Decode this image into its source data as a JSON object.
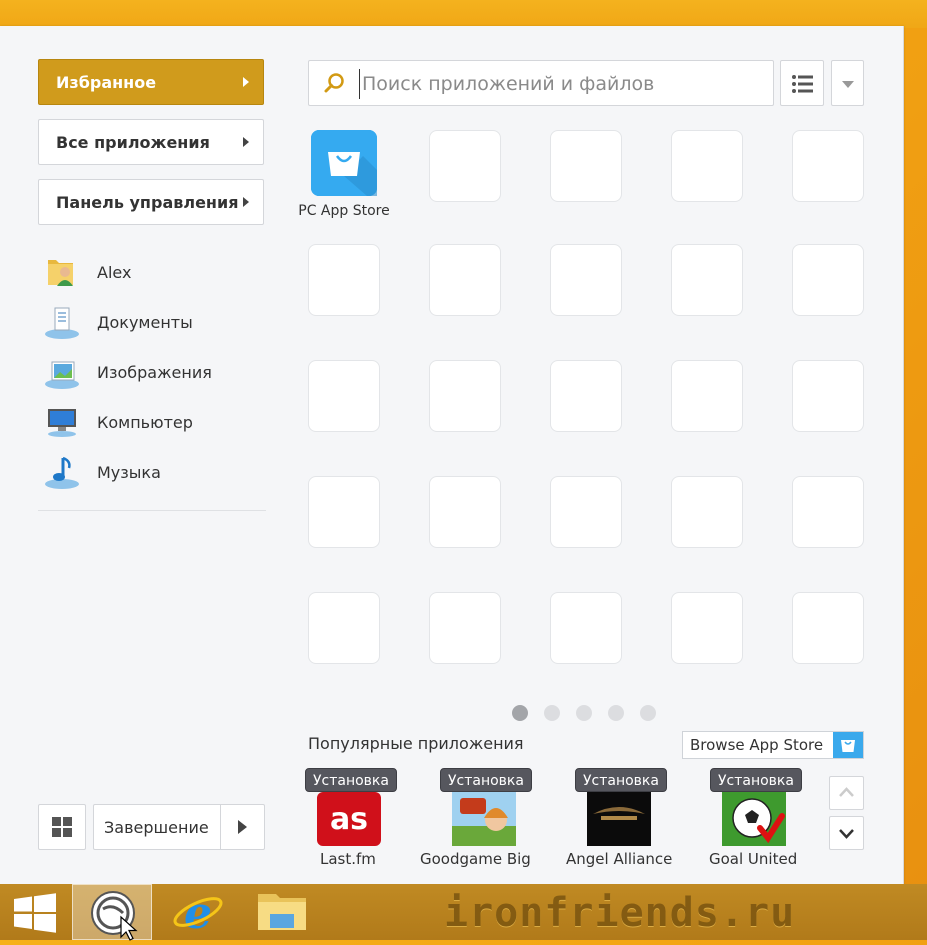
{
  "nav": {
    "favorites": "Избранное",
    "all_apps": "Все приложения",
    "control_panel": "Панель управления"
  },
  "places": [
    {
      "label": "Alex",
      "icon": "user-folder-icon"
    },
    {
      "label": "Документы",
      "icon": "documents-icon"
    },
    {
      "label": "Изображения",
      "icon": "pictures-icon"
    },
    {
      "label": "Компьютер",
      "icon": "computer-icon"
    },
    {
      "label": "Музыка",
      "icon": "music-icon"
    }
  ],
  "search": {
    "placeholder": "Поиск приложений и файлов"
  },
  "apps": [
    {
      "label": "PC App Store",
      "icon": "shopping-bag-icon"
    }
  ],
  "pagination": {
    "pages": 5,
    "current": 1
  },
  "popular": {
    "title": "Популярные приложения",
    "browse_label": "Browse App Store",
    "items": [
      {
        "badge": "Установка",
        "name": "Last.fm"
      },
      {
        "badge": "Установка",
        "name": "Goodgame Big F"
      },
      {
        "badge": "Установка",
        "name": "Angel Alliance"
      },
      {
        "badge": "Установка",
        "name": "Goal United"
      }
    ]
  },
  "footer": {
    "shutdown_label": "Завершение"
  },
  "watermark": "ironfriends.ru",
  "colors": {
    "accent": "#d09b1c",
    "store_blue": "#35aaf0",
    "badge": "#56575e"
  }
}
